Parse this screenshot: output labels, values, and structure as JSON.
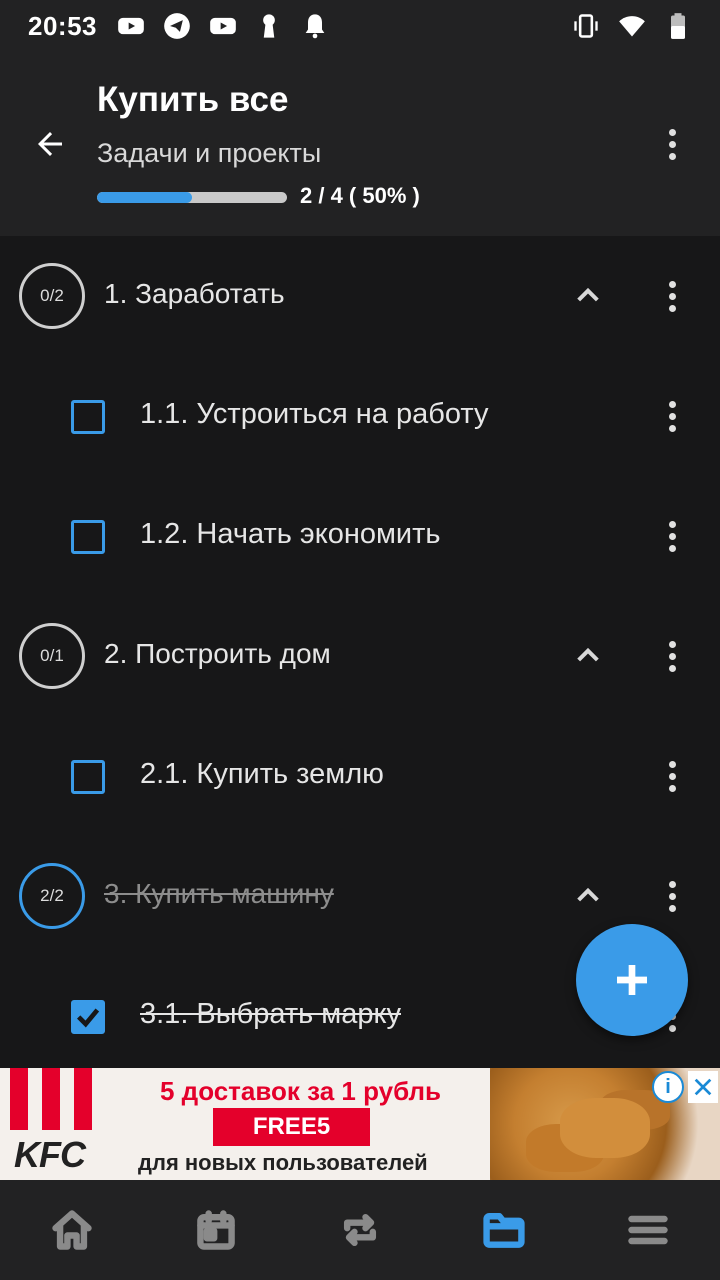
{
  "status_bar": {
    "time": "20:53",
    "left_icons": [
      "youtube-icon",
      "telegram-icon",
      "youtube-icon",
      "keyhole-icon",
      "bell-icon"
    ],
    "right_icons": [
      "vibrate-icon",
      "wifi-icon",
      "battery-icon"
    ]
  },
  "header": {
    "title": "Купить все",
    "subtitle": "Задачи и проекты",
    "progress_fraction": 0.5,
    "progress_text": "2 / 4 ( 50% )"
  },
  "list": {
    "groups": [
      {
        "badge": "0/2",
        "label": "1. Заработать",
        "completed": false,
        "tasks": [
          {
            "label": "1.1. Устроиться на работу",
            "checked": false
          },
          {
            "label": "1.2. Начать экономить",
            "checked": false
          }
        ]
      },
      {
        "badge": "0/1",
        "label": "2. Построить дом",
        "completed": false,
        "tasks": [
          {
            "label": "2.1. Купить землю",
            "checked": false
          }
        ]
      },
      {
        "badge": "2/2",
        "label": "3. Купить машину",
        "completed": true,
        "tasks": [
          {
            "label": "3.1. Выбрать марку",
            "checked": true
          }
        ]
      }
    ]
  },
  "ad": {
    "brand": "KFC",
    "line1": "5 доставок за 1 рубль",
    "code": "FREE5",
    "line2": "для новых пользователей",
    "info": "i"
  },
  "bottom_nav": [
    {
      "icon": "home-icon",
      "active": false
    },
    {
      "icon": "calendar-icon",
      "active": false
    },
    {
      "icon": "repeat-icon",
      "active": false
    },
    {
      "icon": "folder-icon",
      "active": true
    },
    {
      "icon": "menu-icon",
      "active": false
    }
  ],
  "colors": {
    "accent": "#3a9be8",
    "background": "#171718",
    "bar": "#222223"
  }
}
